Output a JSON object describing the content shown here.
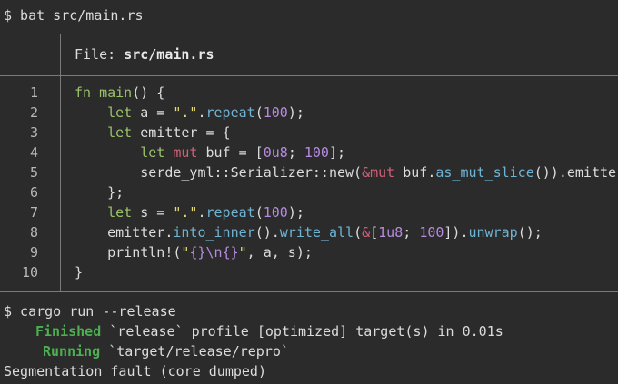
{
  "terminal": {
    "cmd1": "$ bat src/main.rs",
    "file_label": "File: ",
    "file_name": "src/main.rs",
    "code_lines": [
      {
        "n": "1",
        "text": "fn main() {"
      },
      {
        "n": "2",
        "text": "    let a = \".\".repeat(100);"
      },
      {
        "n": "3",
        "text": "    let emitter = {"
      },
      {
        "n": "4",
        "text": "        let mut buf = [0u8; 100];"
      },
      {
        "n": "5",
        "text": "        serde_yml::Serializer::new(&mut buf.as_mut_slice()).emitter"
      },
      {
        "n": "6",
        "text": "    };"
      },
      {
        "n": "7",
        "text": "    let s = \".\".repeat(100);"
      },
      {
        "n": "8",
        "text": "    emitter.into_inner().write_all(&[1u8; 100]).unwrap();"
      },
      {
        "n": "9",
        "text": "    println!(\"{}\\n{}\", a, s);"
      },
      {
        "n": "10",
        "text": "}"
      }
    ],
    "cmd2": "$ cargo run --release",
    "finished_label": "Finished",
    "finished_rest": " `release` profile [optimized] target(s) in 0.01s",
    "running_label": "Running",
    "running_rest": " `target/release/repro`",
    "segfault": "Segmentation fault (core dumped)"
  },
  "colors": {
    "background": "#2b2b2b",
    "keyword": "#9ac26a",
    "mut_keyword": "#d0607a",
    "method": "#6fb3d2",
    "number": "#b78be0",
    "string": "#e6db74",
    "status": "#4caf50"
  }
}
